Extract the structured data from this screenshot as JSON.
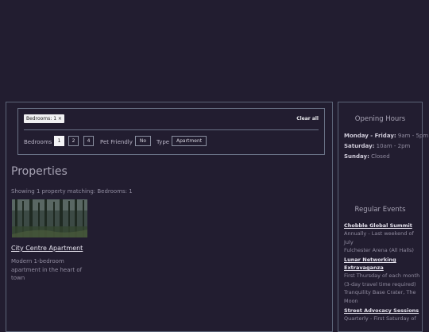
{
  "filters": {
    "active_chip": "Bedrooms: 1 ×",
    "clear_all": "Clear all",
    "bedrooms_label": "Bedrooms",
    "bedroom_options": [
      "1",
      "2",
      "4"
    ],
    "selected_bedrooms": "1",
    "pet_friendly_label": "Pet Friendly",
    "pet_friendly_value": "No",
    "type_label": "Type",
    "type_value": "Apartment"
  },
  "main": {
    "title": "Properties",
    "showing_text": "Showing 1 property matching: Bedrooms: 1",
    "properties": [
      {
        "name": "City Centre Apartment",
        "description": "Modern 1-bedroom apartment in the heart of town"
      }
    ]
  },
  "sidebar": {
    "hours_title": "Opening Hours",
    "hours": [
      {
        "day": "Monday - Friday:",
        "time": "9am - 5pm"
      },
      {
        "day": "Saturday:",
        "time": "10am - 2pm"
      },
      {
        "day": "Sunday:",
        "time": "Closed"
      }
    ],
    "events_title": "Regular Events",
    "events": [
      {
        "title": "Chobble Global Summit",
        "details": [
          "Annually - Last weekend of July",
          "Fulchester Arena (All Halls)"
        ]
      },
      {
        "title": "Lunar Networking Extravaganza",
        "details": [
          "First Thursday of each month (3-day travel time required)",
          "Tranquility Base Crater, The Moon"
        ]
      },
      {
        "title": "Street Advocacy Sessions",
        "details": [
          "Quarterly - First Saturday of"
        ]
      }
    ]
  },
  "colors": {
    "background": "#221d30",
    "border": "#5c6478",
    "text": "#b9b4c6",
    "link": "#e6e3ee"
  }
}
